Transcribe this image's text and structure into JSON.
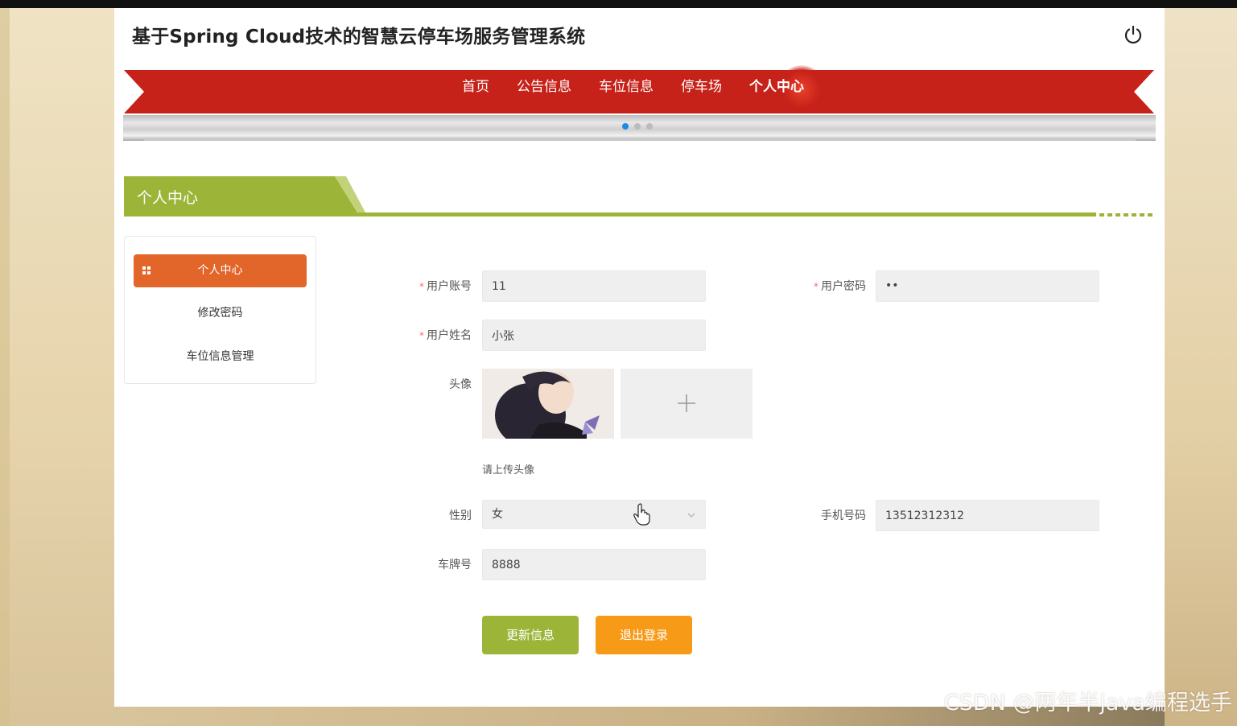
{
  "header": {
    "site_title": "基于Spring Cloud技术的智慧云停车场服务管理系统",
    "power_icon": "power-icon"
  },
  "nav": {
    "items": [
      {
        "label": "首页"
      },
      {
        "label": "公告信息"
      },
      {
        "label": "车位信息"
      },
      {
        "label": "停车场"
      },
      {
        "label": "个人中心"
      }
    ],
    "active_index": 4,
    "ribbon_color": "#c7221a"
  },
  "banner": {
    "dots": 3,
    "active_dot": 0
  },
  "section": {
    "title": "个人中心",
    "accent_color": "#9cb538"
  },
  "sidebar": {
    "items": [
      {
        "label": "个人中心"
      },
      {
        "label": "修改密码"
      },
      {
        "label": "车位信息管理"
      }
    ],
    "active_color": "#e2652a"
  },
  "form": {
    "account": {
      "label": "用户账号",
      "value": "11"
    },
    "password": {
      "label": "用户密码",
      "value": "••"
    },
    "name": {
      "label": "用户姓名",
      "value": "小张"
    },
    "avatar": {
      "label": "头像",
      "hint": "请上传头像"
    },
    "gender": {
      "label": "性别",
      "value": "女"
    },
    "phone": {
      "label": "手机号码",
      "value": "13512312312"
    },
    "plate": {
      "label": "车牌号",
      "value": "8888"
    }
  },
  "buttons": {
    "update": "更新信息",
    "logout": "退出登录",
    "update_color": "#9cb538",
    "logout_color": "#f79a17"
  },
  "watermark": "CSDN @两年半java编程选手"
}
